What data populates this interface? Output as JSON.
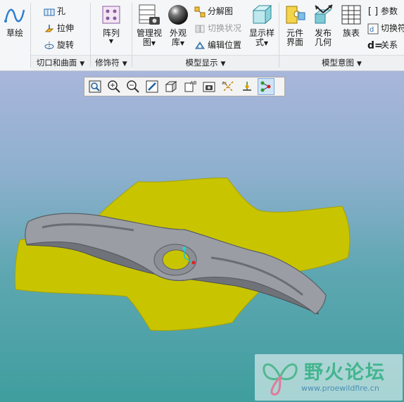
{
  "ribbon": {
    "sketch": {
      "label": "草绘"
    },
    "hole": {
      "label": "孔"
    },
    "extrude": {
      "label": "拉伸"
    },
    "revolve": {
      "label": "旋转"
    },
    "pattern": {
      "label": "阵列"
    },
    "manage_views": {
      "label1": "管理视",
      "label2": "图"
    },
    "appearance": {
      "label1": "外观",
      "label2": "库"
    },
    "exploded_view": {
      "label": "分解图"
    },
    "toggle_status": {
      "label": "切换状况"
    },
    "edit_position": {
      "label": "编辑位置"
    },
    "display_style": {
      "label1": "显示样",
      "label2": "式"
    },
    "component_interface": {
      "label1": "元件",
      "label2": "界面"
    },
    "publish_geometry": {
      "label1": "发布",
      "label2": "几何"
    },
    "family_table": {
      "label": "族表"
    },
    "parameters": {
      "label": "参数"
    },
    "switch_symbols": {
      "label": "切换符"
    },
    "relations": {
      "label": "关系"
    },
    "groups": {
      "engineering": "切口和曲面",
      "cosmetic": "修饰符",
      "model_display": "模型显示",
      "model_intent": "模型意图"
    },
    "dropdown_glyph": "▼"
  },
  "view_toolbar": {
    "tools": [
      "refit-icon",
      "zoom-in-icon",
      "zoom-out-icon",
      "repaint-icon",
      "display-style-icon",
      "saved-views-icon",
      "view-manager-icon",
      "datum-display-icon",
      "spin-center-icon",
      "annotation-display-icon"
    ]
  },
  "watermark": {
    "title": "野火论坛",
    "url": "www.proewildfire.cn"
  },
  "colors": {
    "surface_yellow": "#c8c400",
    "part_gray": "#8a8e94",
    "viewport_top": "#a9b6dc",
    "viewport_bottom": "#3f9e9e",
    "watermark_green": "#43b58e"
  }
}
